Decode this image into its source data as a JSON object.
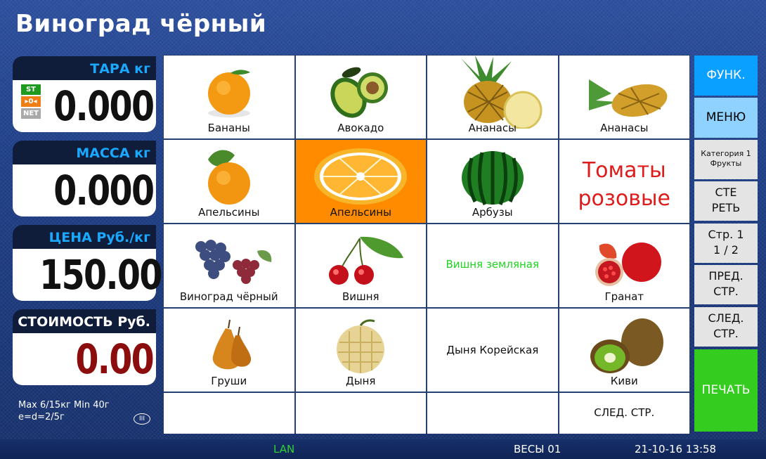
{
  "header": {
    "title": "Виноград чёрный"
  },
  "tare": {
    "label": "ТАРА кг",
    "value": "0.000",
    "badges": [
      "ST",
      "▸0◂",
      "NET"
    ]
  },
  "mass": {
    "label": "МАССА кг",
    "value": "0.000"
  },
  "price": {
    "label": "ЦЕНА Руб./кг",
    "value": "150.00"
  },
  "cost": {
    "label": "СТОИМОСТЬ Руб.",
    "value": "0.00"
  },
  "spec": {
    "line1": "Max 6/15кг Min 40г",
    "line2": "e=d=2/5г",
    "class": "III"
  },
  "products": [
    {
      "label": "Бананы",
      "icon": "orange-icon"
    },
    {
      "label": "Авокадо",
      "icon": "avocado-icon"
    },
    {
      "label": "Ананасы",
      "icon": "pineapple-icon"
    },
    {
      "label": "Ананасы",
      "icon": "pineapple-icon"
    },
    {
      "label": "Апельсины",
      "icon": "orange-icon"
    },
    {
      "label": "Апельсины",
      "icon": "orange-slice-icon"
    },
    {
      "label": "Арбузы",
      "icon": "watermelon-icon"
    },
    {
      "label": "Томаты розовые",
      "icon": ""
    },
    {
      "label": "Виноград чёрный",
      "icon": "grapes-icon"
    },
    {
      "label": "Вишня",
      "icon": "cherry-icon"
    },
    {
      "label": "Вишня земляная",
      "icon": ""
    },
    {
      "label": "Гранат",
      "icon": "pomegranate-icon"
    },
    {
      "label": "Груши",
      "icon": "pear-icon"
    },
    {
      "label": "Дыня",
      "icon": "melon-icon"
    },
    {
      "label": "Дыня Корейская",
      "icon": ""
    },
    {
      "label": "Киви",
      "icon": "kiwi-icon"
    }
  ],
  "grid_nav": {
    "next_label": "СЛЕД. СТР."
  },
  "sidebar": {
    "func": "ФУНК.",
    "menu": "МЕНЮ",
    "category_line1": "Категория 1",
    "category_line2": "Фрукты",
    "erase_line1": "СТЕ",
    "erase_line2": "РЕТЬ",
    "page_line1": "Стр. 1",
    "page_line2": "1 / 2",
    "prev_line1": "ПРЕД.",
    "prev_line2": "СТР.",
    "next_line1": "СЛЕД.",
    "next_line2": "СТР.",
    "print": "ПЕЧАТЬ"
  },
  "status": {
    "lan": "LAN",
    "scale": "ВЕСЫ 01",
    "datetime": "21-10-16 13:58"
  },
  "colors": {
    "selected": "#ff8c00",
    "func": "#0aa0ff",
    "print": "#34cc1f",
    "accent_label": "#19a9ff",
    "cost_value": "#8b0d0d",
    "tomato_text": "#e01b1b",
    "green_text": "#1ed41e"
  }
}
